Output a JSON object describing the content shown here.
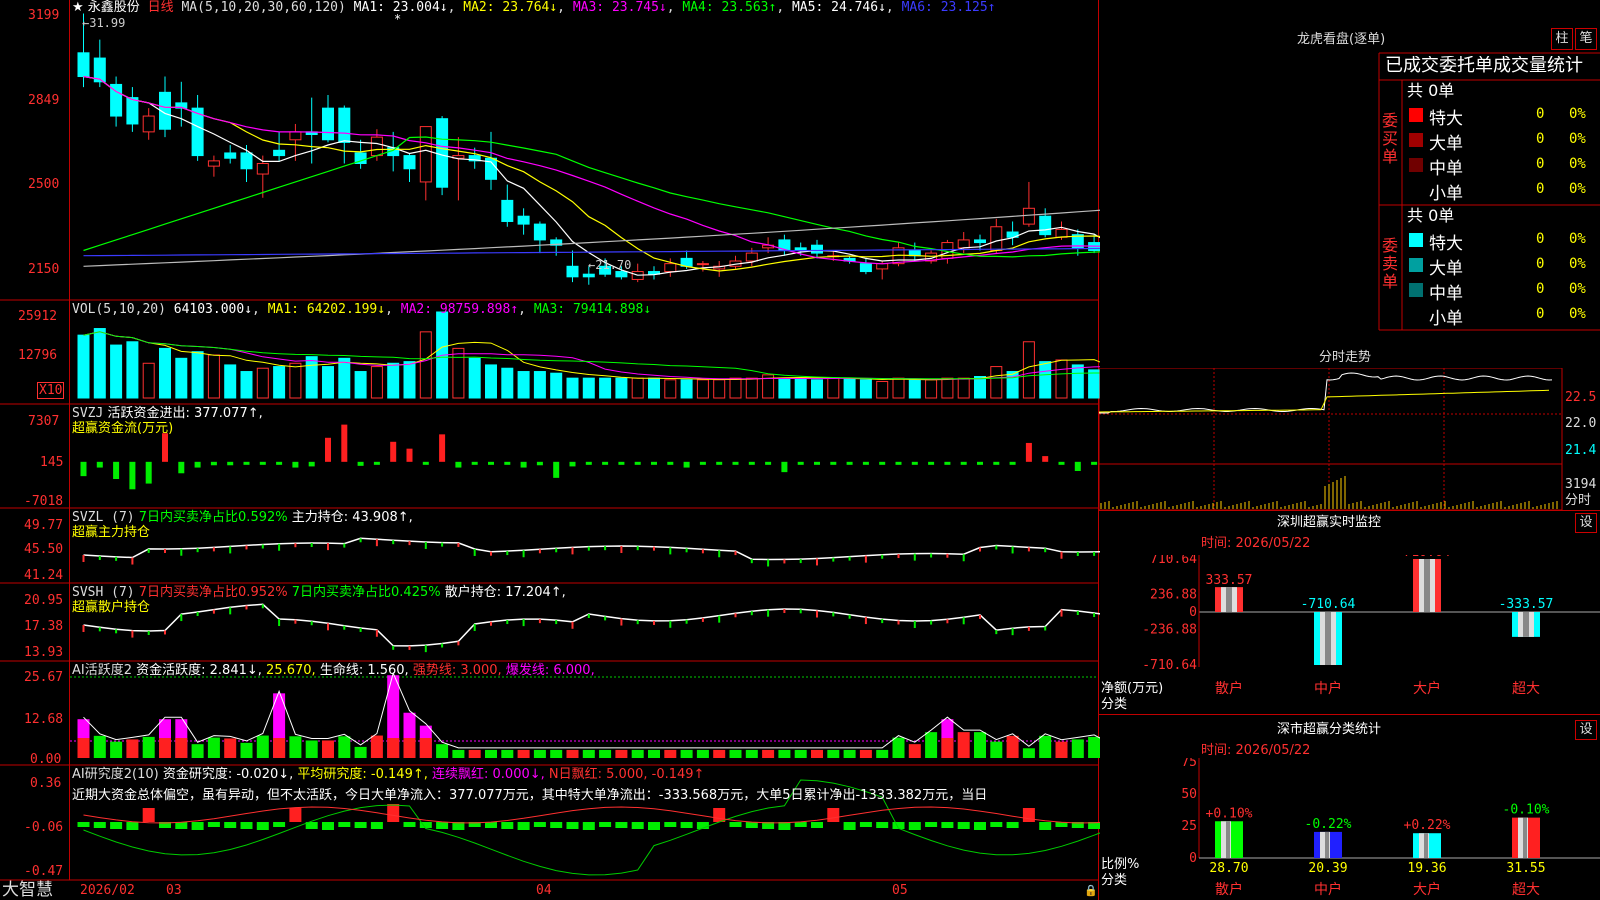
{
  "main": {
    "title": "★ 永鑫股份",
    "period": "日线",
    "ma_header": "MA(5,10,20,30,60,120)",
    "ma_values": [
      {
        "label": "MA1: 23.004↓",
        "color": "#ffffff"
      },
      {
        "label": "MA2: 23.764↓",
        "color": "#ffff00"
      },
      {
        "label": "MA3: 23.745↓",
        "color": "#ff00ff"
      },
      {
        "label": "MA4: 23.563↑",
        "color": "#00ff00"
      },
      {
        "label": "MA5: 24.746↓",
        "color": "#ffffff"
      },
      {
        "label": "MA6: 23.125↑",
        "color": "#3b3bff"
      }
    ],
    "y_ticks": [
      "3199",
      "2849",
      "2500",
      "2150"
    ],
    "high_label": "31.99",
    "low_label": "21.70",
    "star": "*"
  },
  "vol": {
    "header": "VOL(5,10,20)",
    "value": "64103.000↓",
    "ma1": "MA1: 64202.199↓",
    "ma2": "MA2: 98759.898↑",
    "ma3": "MA3: 79414.898↓",
    "y_ticks": [
      "25912",
      "12796"
    ],
    "unit": "X10"
  },
  "svzj": {
    "header": "SVZJ",
    "label": "活跃资金进出: 377.077↑,",
    "sub": "超赢资金流(万元)",
    "y_ticks": [
      "7307",
      "145",
      "-7018"
    ]
  },
  "svzl": {
    "header": "SVZL (7)",
    "part1": "7日内买卖净占比0.592%",
    "part2": "主力持仓: 43.908↑,",
    "sub": "超赢主力持仓",
    "y_ticks": [
      "49.77",
      "45.50",
      "41.24"
    ]
  },
  "svsh": {
    "header": "SVSH (7)",
    "part1": "7日内买卖净占比0.952%",
    "part2": "7日内买卖净占比0.425%",
    "part3": "散户持仓: 17.204↑,",
    "sub": "超赢散户持仓",
    "y_ticks": [
      "20.95",
      "17.38",
      "13.93"
    ]
  },
  "ai1": {
    "header": "AI活跃度2",
    "part1": "资金活跃度: 2.841↓,",
    "part2": "25.670,",
    "part3": "生命线: 1.560,",
    "part4": "强势线: 3.000,",
    "part5": "爆发线: 6.000,",
    "y_ticks": [
      "25.67",
      "12.68",
      "0.00"
    ]
  },
  "ai2": {
    "header": "AI研究度2(10)",
    "part1": "资金研究度: -0.020↓,",
    "part2": "平均研究度: -0.149↑,",
    "part3": "连续飘红: 0.000↓,",
    "part4": "N日飘红: 5.000, -0.149↑",
    "note": "近期大资金总体偏空，虽有异动，但不太活跃，今日大单净流入：377.077万元，其中特大单净流出：-333.568万元，大单5日累计净出-1333.382万元，当日",
    "y_ticks": [
      "0.36",
      "-0.06",
      "-0.47"
    ]
  },
  "bottom_axis": {
    "brand": "大智慧",
    "labels": [
      "2026/02",
      "03",
      "04",
      "05"
    ]
  },
  "right": {
    "dragon": {
      "title": "龙虎看盘(逐单)",
      "btn1": "柱",
      "btn2": "笔",
      "heading": "已成交委托单成交量统计",
      "buy_side": "委买单",
      "sell_side": "委卖单",
      "buy_total": "共 0单",
      "sell_total": "共 0单",
      "buy_rows": [
        {
          "label": "特大",
          "count": "0",
          "pct": "0%",
          "color": "#ff0000"
        },
        {
          "label": "大单",
          "count": "0",
          "pct": "0%",
          "color": "#a00000"
        },
        {
          "label": "中单",
          "count": "0",
          "pct": "0%",
          "color": "#700000"
        },
        {
          "label": "小单",
          "count": "0",
          "pct": "0%",
          "color": "#000000"
        }
      ],
      "sell_rows": [
        {
          "label": "特大",
          "count": "0",
          "pct": "0%",
          "color": "#00ffff"
        },
        {
          "label": "大单",
          "count": "0",
          "pct": "0%",
          "color": "#00a0a0"
        },
        {
          "label": "中单",
          "count": "0",
          "pct": "0%",
          "color": "#007070"
        },
        {
          "label": "小单",
          "count": "0",
          "pct": "0%",
          "color": "#000000"
        }
      ]
    },
    "intraday": {
      "title": "分时走势",
      "y_ticks": [
        "22.5",
        "22.0",
        "21.4"
      ],
      "vol_tick": "3194",
      "vol_label": "分时"
    },
    "monitor": {
      "title": "深圳超赢实时监控",
      "settings": "设",
      "time": "时间: 2026/05/22",
      "y_ticks": [
        "710.64",
        "236.88",
        "0",
        "-236.88",
        "-710.64"
      ],
      "y_unit": "净额(万元)",
      "x_unit": "分类",
      "bars": [
        {
          "category": "散户",
          "value": 333.57,
          "label": "333.57"
        },
        {
          "category": "中户",
          "value": -710.64,
          "label": "-710.64"
        },
        {
          "category": "大户",
          "value": 710.64,
          "label": "710.64"
        },
        {
          "category": "超大",
          "value": -333.57,
          "label": "-333.57"
        }
      ]
    },
    "classify": {
      "title": "深市超赢分类统计",
      "settings": "设",
      "time": "时间: 2026/05/22",
      "y_ticks": [
        "75",
        "50",
        "25",
        "0"
      ],
      "y_unit": "比例%",
      "x_unit": "分类",
      "bars": [
        {
          "category": "散户",
          "value": 28.7,
          "change": "+0.10%",
          "label": "28.70",
          "color": "#00ff00"
        },
        {
          "category": "中户",
          "value": 20.39,
          "change": "-0.22%",
          "label": "20.39",
          "color": "#2020ff"
        },
        {
          "category": "大户",
          "value": 19.36,
          "change": "+0.22%",
          "label": "19.36",
          "color": "#00ffff"
        },
        {
          "category": "超大",
          "value": 31.55,
          "change": "-0.10%",
          "label": "31.55",
          "color": "#ff2020"
        }
      ]
    }
  },
  "chart_data": [
    {
      "type": "candlestick",
      "title": "永鑫股份 日线",
      "ylim": [
        21.5,
        32.2
      ],
      "x": [
        "2026/02",
        "03",
        "04",
        "05"
      ],
      "ohlc": [
        [
          30.5,
          31.99,
          29.2,
          29.6
        ],
        [
          30.3,
          31.0,
          29.2,
          29.4
        ],
        [
          29.3,
          29.6,
          27.7,
          28.1
        ],
        [
          28.8,
          29.2,
          27.5,
          27.8
        ],
        [
          27.5,
          28.4,
          27.2,
          28.1
        ],
        [
          29.0,
          29.6,
          27.3,
          27.6
        ],
        [
          28.6,
          29.4,
          27.7,
          28.4
        ],
        [
          28.4,
          28.9,
          26.4,
          26.6
        ],
        [
          26.2,
          26.6,
          25.8,
          26.4
        ],
        [
          26.7,
          27.0,
          26.3,
          26.5
        ],
        [
          26.7,
          27.0,
          25.6,
          26.1
        ],
        [
          25.9,
          26.6,
          25.0,
          26.3
        ],
        [
          26.8,
          27.5,
          26.4,
          26.6
        ],
        [
          27.2,
          27.8,
          26.4,
          27.5
        ],
        [
          27.5,
          28.8,
          26.3,
          27.4
        ],
        [
          28.4,
          28.9,
          27.1,
          27.2
        ],
        [
          28.4,
          28.5,
          26.3,
          27.1
        ],
        [
          26.7,
          27.2,
          26.1,
          26.3
        ],
        [
          26.6,
          27.6,
          26.4,
          27.3
        ],
        [
          26.9,
          27.5,
          26.0,
          26.6
        ],
        [
          26.6,
          26.7,
          25.6,
          26.1
        ],
        [
          25.6,
          27.7,
          24.9,
          27.7
        ],
        [
          28.0,
          28.1,
          25.1,
          25.4
        ],
        [
          26.5,
          27.3,
          24.9,
          26.6
        ],
        [
          26.6,
          26.9,
          26.1,
          26.4
        ],
        [
          26.5,
          27.5,
          25.3,
          25.7
        ],
        [
          24.9,
          25.5,
          23.9,
          24.1
        ],
        [
          24.3,
          24.6,
          23.6,
          24.0
        ],
        [
          24.0,
          24.1,
          22.9,
          23.4
        ],
        [
          23.4,
          23.5,
          22.8,
          23.2
        ],
        [
          22.4,
          23.0,
          21.8,
          22.0
        ],
        [
          22.1,
          22.4,
          21.7,
          22.0
        ],
        [
          22.4,
          22.7,
          22.0,
          22.1
        ],
        [
          22.2,
          22.4,
          21.9,
          22.0
        ],
        [
          21.9,
          22.5,
          21.8,
          22.2
        ],
        [
          22.2,
          22.4,
          21.9,
          22.1
        ],
        [
          22.2,
          22.7,
          22.0,
          22.5
        ],
        [
          22.7,
          23.0,
          22.3,
          22.4
        ],
        [
          22.5,
          22.6,
          22.2,
          22.5
        ],
        [
          22.3,
          22.6,
          22.0,
          22.4
        ],
        [
          22.4,
          22.8,
          22.3,
          22.6
        ],
        [
          22.6,
          23.1,
          22.4,
          22.9
        ],
        [
          23.1,
          23.5,
          22.9,
          23.2
        ],
        [
          23.4,
          23.6,
          22.8,
          23.0
        ],
        [
          23.1,
          23.3,
          22.8,
          23.0
        ],
        [
          23.2,
          23.4,
          22.7,
          22.9
        ],
        [
          22.8,
          23.0,
          22.6,
          22.8
        ],
        [
          22.7,
          22.8,
          22.5,
          22.6
        ],
        [
          22.5,
          22.7,
          22.1,
          22.2
        ],
        [
          22.3,
          22.6,
          21.9,
          22.5
        ],
        [
          22.5,
          23.3,
          22.4,
          23.1
        ],
        [
          23.0,
          23.3,
          22.6,
          22.8
        ],
        [
          22.6,
          23.0,
          22.5,
          22.9
        ],
        [
          22.7,
          23.4,
          22.5,
          23.3
        ],
        [
          23.1,
          23.7,
          22.9,
          23.4
        ],
        [
          23.4,
          23.6,
          23.0,
          23.3
        ],
        [
          23.0,
          24.2,
          22.9,
          23.9
        ],
        [
          23.7,
          24.1,
          23.2,
          23.5
        ],
        [
          24.0,
          25.6,
          23.9,
          24.6
        ],
        [
          24.3,
          24.6,
          23.5,
          23.6
        ],
        [
          23.5,
          24.1,
          23.4,
          23.8
        ],
        [
          23.6,
          23.8,
          22.8,
          23.1
        ],
        [
          23.3,
          23.6,
          22.9,
          23.0
        ],
        [
          22.9,
          23.2,
          22.6,
          22.8
        ],
        [
          23.2,
          23.3,
          22.7,
          22.9
        ],
        [
          23.0,
          23.1,
          22.6,
          22.9
        ],
        [
          22.7,
          22.9,
          21.8,
          22.0
        ],
        [
          22.2,
          23.1,
          22.0,
          23.0
        ]
      ],
      "series": [
        {
          "name": "MA1",
          "color": "#ffffff"
        },
        {
          "name": "MA2",
          "color": "#ffff00"
        },
        {
          "name": "MA3",
          "color": "#ff00ff"
        },
        {
          "name": "MA4",
          "color": "#00ff00"
        },
        {
          "name": "MA5",
          "color": "#ffffff"
        },
        {
          "name": "MA6",
          "color": "#3b3bff"
        }
      ]
    },
    {
      "type": "bar",
      "title": "VOL(5,10,20)",
      "ylim": [
        0,
        26000
      ],
      "values": [
        19000,
        21000,
        16000,
        17000,
        10500,
        15000,
        12000,
        14000,
        13000,
        10000,
        8000,
        9000,
        9500,
        10500,
        12500,
        9500,
        12000,
        8000,
        9500,
        10500,
        11000,
        20000,
        26000,
        15000,
        12000,
        10000,
        9000,
        8000,
        8000,
        7500,
        6000,
        6000,
        6000,
        6000,
        6000,
        6000,
        5500,
        5500,
        5500,
        5500,
        6000,
        6000,
        7000,
        6000,
        6000,
        5500,
        6000,
        6000,
        5500,
        5000,
        6000,
        5500,
        5500,
        6000,
        6000,
        6500,
        9500,
        8000,
        17000,
        11000,
        11500,
        10000,
        8500,
        7000,
        7500,
        6500,
        7000,
        6000
      ]
    },
    {
      "type": "bar",
      "title": "超赢资金流(万元)",
      "ylim": [
        -7018,
        7307
      ],
      "values": [
        -2500,
        -1000,
        -3000,
        -4800,
        -3800,
        5000,
        -2000,
        -1000,
        -600,
        -600,
        -500,
        -500,
        -300,
        -1000,
        -800,
        4200,
        6500,
        -700,
        -500,
        3500,
        2300,
        -500,
        4800,
        -1000,
        -300,
        -500,
        -500,
        -1000,
        -600,
        -2800,
        -800,
        -300,
        -300,
        -300,
        -500,
        -300,
        -500,
        -1000,
        -300,
        -300,
        -500,
        -300,
        -300,
        -1800,
        -300,
        -300,
        -300,
        -300,
        -300,
        -300,
        -300,
        -300,
        -300,
        -300,
        -300,
        -300,
        -300,
        -300,
        3300,
        1000,
        -500,
        -1600,
        -500,
        -500,
        -500,
        -500,
        -500,
        -300
      ]
    }
  ]
}
